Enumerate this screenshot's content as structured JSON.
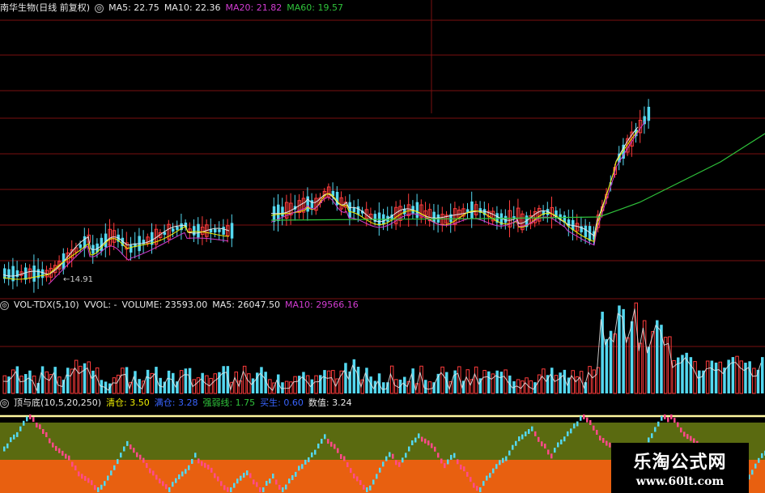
{
  "price_header": {
    "stock": "南华生物(日线 前复权)",
    "ma5_label": "MA5: 22.75",
    "ma10_label": "MA10: 22.36",
    "ma20_label": "MA20: 21.82",
    "ma60_label": "MA60: 19.57"
  },
  "price_low_label": "←14.91",
  "vol_header": {
    "name": "VOL-TDX(5,10)",
    "vvol": "VVOL: -",
    "volume": "VOLUME: 23593.00",
    "ma5": "MA5: 26047.50",
    "ma10": "MA10: 29566.16"
  },
  "ind_header": {
    "name": "顶与底(10,5,20,250)",
    "qingcang": "清仓: 3.50",
    "item2": "满仓: 3.28",
    "ruoqiang": "强弱线: 1.75",
    "item4": "买生: 0.60",
    "shuzhi": "数值: 3.24"
  },
  "watermark": {
    "title": "乐淘公式网",
    "url": "www.60lt.com"
  },
  "colors": {
    "up": "#ff3c3c",
    "down": "#54d8f0",
    "ma5": "#e8e8e8",
    "ma10": "#f0f000",
    "ma20": "#d23cd2",
    "ma60": "#2fc33b",
    "grid": "#7a1010",
    "ind_olive": "#5a6a10",
    "ind_orange": "#e86010",
    "ind_line": "#fff8a0"
  },
  "chart_data": {
    "type": "candlestick",
    "price_low": 14.91,
    "ma_values": {
      "MA5": 22.75,
      "MA10": 22.36,
      "MA20": 21.82,
      "MA60": 19.57
    },
    "volume": {
      "VOLUME": 23593.0,
      "MA5": 26047.5,
      "MA10": 29566.16
    },
    "indicator": {
      "清仓": 3.5,
      "满仓": 3.28,
      "强弱线": 1.75,
      "买生": 0.6,
      "数值": 3.24
    }
  }
}
